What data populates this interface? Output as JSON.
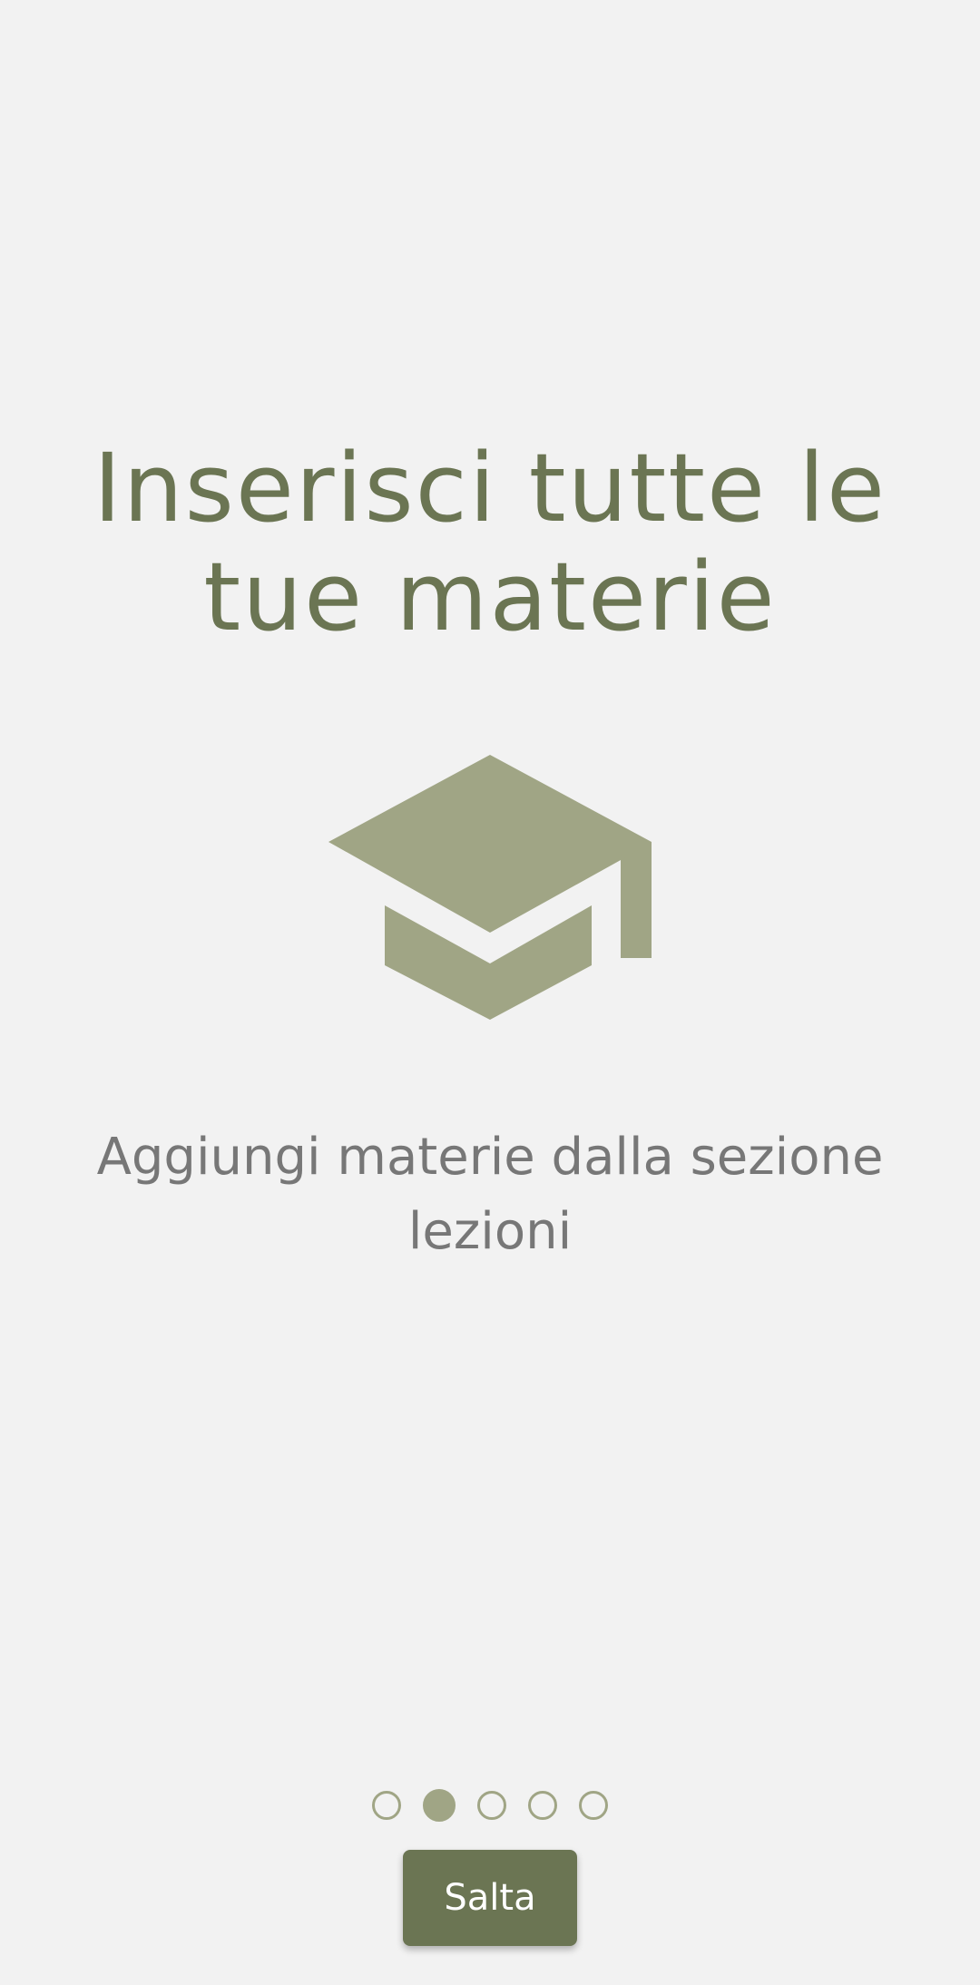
{
  "slide": {
    "title": "Inserisci tutte le tue materie",
    "icon": "graduation-cap-icon",
    "description": "Aggiungi materie dalla sezione lezioni"
  },
  "pager": {
    "total_pages": 5,
    "active_page": 2
  },
  "skip_button": {
    "label": "Salta"
  },
  "colors": {
    "background": "#f2f2f2",
    "title": "#6b7553",
    "icon": "#a0a585",
    "description": "#777777",
    "dot": "#a0a585",
    "button": "#6b7553",
    "button_text": "#ffffff"
  }
}
